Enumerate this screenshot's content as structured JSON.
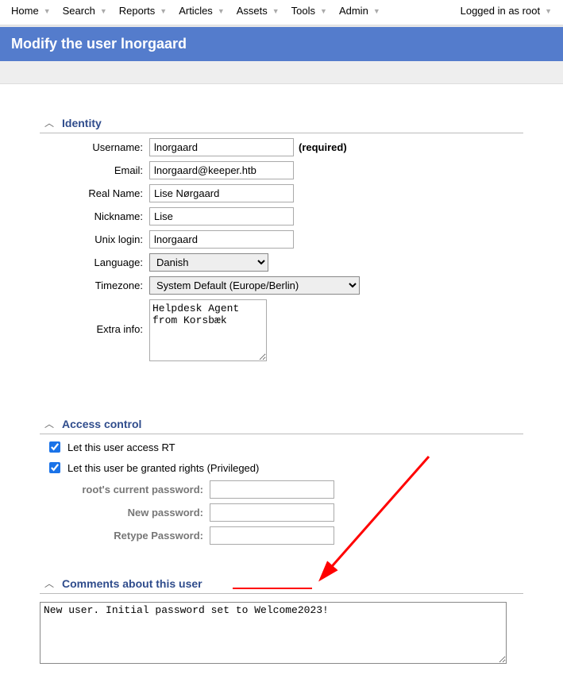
{
  "nav": {
    "items": [
      {
        "label": "Home"
      },
      {
        "label": "Search"
      },
      {
        "label": "Reports"
      },
      {
        "label": "Articles"
      },
      {
        "label": "Assets"
      },
      {
        "label": "Tools"
      },
      {
        "label": "Admin"
      },
      {
        "label": "Logged in as root"
      }
    ]
  },
  "page_title": "Modify the user lnorgaard",
  "sections": {
    "identity": {
      "title": "Identity",
      "labels": {
        "username": "Username:",
        "email": "Email:",
        "realname": "Real Name:",
        "nickname": "Nickname:",
        "unix": "Unix login:",
        "language": "Language:",
        "timezone": "Timezone:",
        "extra": "Extra info:"
      },
      "values": {
        "username": "lnorgaard",
        "email": "lnorgaard@keeper.htb",
        "realname": "Lise Nørgaard",
        "nickname": "Lise",
        "unix": "lnorgaard",
        "language": "Danish",
        "timezone": "System Default (Europe/Berlin)",
        "extra": "Helpdesk Agent from Korsbæk"
      },
      "required_text": "(required)"
    },
    "access": {
      "title": "Access control",
      "check1": "Let this user access RT",
      "check2": "Let this user be granted rights (Privileged)",
      "pw_labels": {
        "current": "root's current password:",
        "new": "New password:",
        "retype": "Retype Password:"
      }
    },
    "comments": {
      "title": "Comments about this user",
      "value": "New user. Initial password set to Welcome2023!"
    }
  }
}
